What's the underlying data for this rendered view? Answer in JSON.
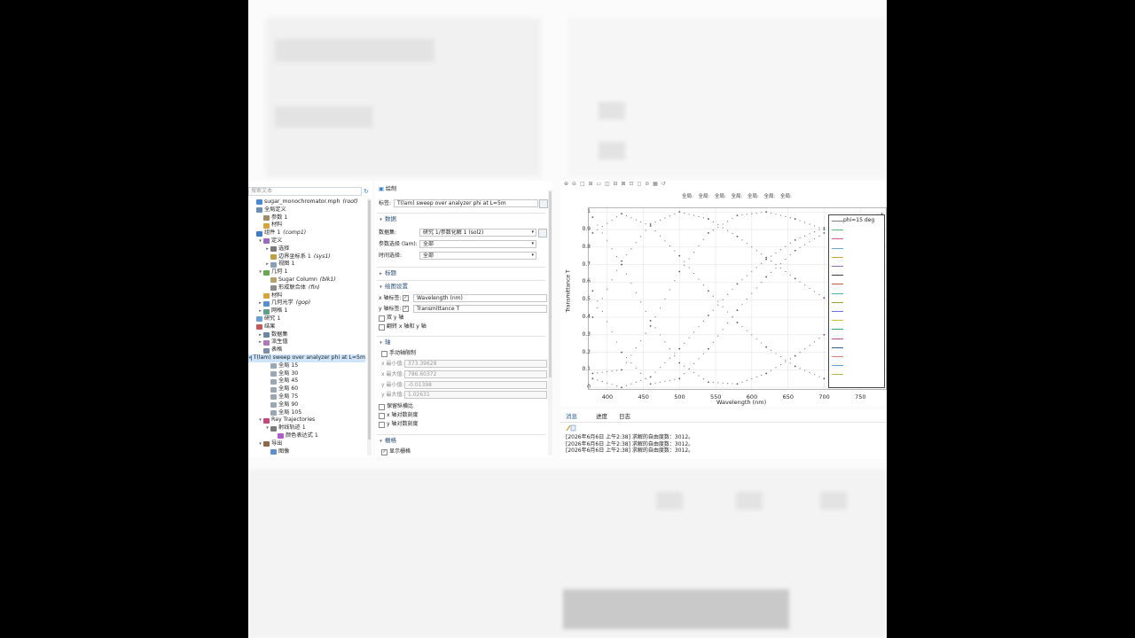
{
  "tree": {
    "search_placeholder": "搜索文本",
    "items": [
      {
        "label": "sugar_monochromator.mph",
        "tag": "(root)",
        "level": 0,
        "toggle": "",
        "icon": "file-icon",
        "color": "#4a8bd1"
      },
      {
        "label": "全局定义",
        "tag": "",
        "level": 0,
        "toggle": "",
        "icon": "globe-icon",
        "color": "#6c8fb5"
      },
      {
        "label": "参数 1",
        "tag": "",
        "level": 1,
        "toggle": "",
        "icon": "parameter-icon",
        "color": "#a08b6a"
      },
      {
        "label": "材料",
        "tag": "",
        "level": 1,
        "toggle": "",
        "icon": "materials-icon",
        "color": "#d8a43a"
      },
      {
        "label": "组件 1",
        "tag": "(comp1)",
        "level": 0,
        "toggle": "",
        "icon": "component-icon",
        "color": "#3e7cc4"
      },
      {
        "label": "定义",
        "tag": "",
        "level": 1,
        "toggle": "▾",
        "icon": "definitions-icon",
        "color": "#9a6bbf"
      },
      {
        "label": "选择",
        "tag": "",
        "level": 2,
        "toggle": "▸",
        "icon": "selection-icon",
        "color": "#7a7a7a"
      },
      {
        "label": "边界坐标系 1",
        "tag": "(sys1)",
        "level": 2,
        "toggle": "",
        "icon": "coordinate-system-icon",
        "color": "#c0a040"
      },
      {
        "label": "视图 1",
        "tag": "",
        "level": 2,
        "toggle": "▸",
        "icon": "view-icon",
        "color": "#8aa0b8"
      },
      {
        "label": "几何 1",
        "tag": "",
        "level": 1,
        "toggle": "▾",
        "icon": "geometry-icon",
        "color": "#6aa84f"
      },
      {
        "label": "Sugar Column",
        "tag": "(blk1)",
        "level": 2,
        "toggle": "",
        "icon": "block-icon",
        "color": "#b5a36e"
      },
      {
        "label": "形成联合体",
        "tag": "(fin)",
        "level": 2,
        "toggle": "",
        "icon": "form-union-icon",
        "color": "#8c8c8c"
      },
      {
        "label": "材料",
        "tag": "",
        "level": 1,
        "toggle": "",
        "icon": "materials-icon",
        "color": "#d8a43a"
      },
      {
        "label": "几何光学",
        "tag": "(gop)",
        "level": 1,
        "toggle": "▸",
        "icon": "geometrical-optics-icon",
        "color": "#5a8ecf"
      },
      {
        "label": "网格 1",
        "tag": "",
        "level": 1,
        "toggle": "▸",
        "icon": "mesh-icon",
        "color": "#5e9f8a"
      },
      {
        "label": "研究 1",
        "tag": "",
        "level": 0,
        "toggle": "",
        "icon": "study-icon",
        "color": "#6aa0d8"
      },
      {
        "label": "结果",
        "tag": "",
        "level": 0,
        "toggle": "",
        "icon": "results-icon",
        "color": "#c65a5a"
      },
      {
        "label": "数据集",
        "tag": "",
        "level": 1,
        "toggle": "▸",
        "icon": "datasets-icon",
        "color": "#6b86a6"
      },
      {
        "label": "派生值",
        "tag": "",
        "level": 1,
        "toggle": "▸",
        "icon": "derived-values-icon",
        "color": "#b07ab8"
      },
      {
        "label": "表格",
        "tag": "",
        "level": 1,
        "toggle": "",
        "icon": "tables-icon",
        "color": "#7c8fa8"
      },
      {
        "label": "T(lam) sweep over analyzer phi at L=5m",
        "tag": "",
        "level": 1,
        "toggle": "▾",
        "icon": "1d-plot-group-icon",
        "color": "#4f80b8",
        "selected": true
      },
      {
        "label": "全局 15",
        "tag": "",
        "level": 2,
        "toggle": "",
        "icon": "global-plot-icon",
        "color": "#9aa7b5"
      },
      {
        "label": "全局 30",
        "tag": "",
        "level": 2,
        "toggle": "",
        "icon": "global-plot-icon",
        "color": "#9aa7b5"
      },
      {
        "label": "全局 45",
        "tag": "",
        "level": 2,
        "toggle": "",
        "icon": "global-plot-icon",
        "color": "#9aa7b5"
      },
      {
        "label": "全局 60",
        "tag": "",
        "level": 2,
        "toggle": "",
        "icon": "global-plot-icon",
        "color": "#9aa7b5"
      },
      {
        "label": "全局 75",
        "tag": "",
        "level": 2,
        "toggle": "",
        "icon": "global-plot-icon",
        "color": "#9aa7b5"
      },
      {
        "label": "全局 90",
        "tag": "",
        "level": 2,
        "toggle": "",
        "icon": "global-plot-icon",
        "color": "#9aa7b5"
      },
      {
        "label": "全局 105",
        "tag": "",
        "level": 2,
        "toggle": "",
        "icon": "global-plot-icon",
        "color": "#9aa7b5"
      },
      {
        "label": "Ray Trajectories",
        "tag": "",
        "level": 1,
        "toggle": "▾",
        "icon": "ray-trajectories-icon",
        "color": "#c04a7a"
      },
      {
        "label": "射线轨迹 1",
        "tag": "",
        "level": 2,
        "toggle": "▾",
        "icon": "ray-trajectory-icon",
        "color": "#7a7a7a"
      },
      {
        "label": "颜色表达式 1",
        "tag": "",
        "level": 3,
        "toggle": "",
        "icon": "color-expression-icon",
        "color": "#b15cc8"
      },
      {
        "label": "导出",
        "tag": "",
        "level": 1,
        "toggle": "▾",
        "icon": "export-icon",
        "color": "#8a6a4a"
      },
      {
        "label": "图像",
        "tag": "",
        "level": 2,
        "toggle": "",
        "icon": "image-icon",
        "color": "#5a8ecf"
      }
    ]
  },
  "settings": {
    "header": "绘制",
    "label_label": "标签:",
    "label_value": "T(lam) sweep over analyzer phi at L=5m",
    "data_section": "数据",
    "dataset_label": "数据集:",
    "dataset_value": "研究 1/参数化解 1 (sol2)",
    "param_label": "参数选择 (lam):",
    "param_value": "全部",
    "time_label": "时间选择:",
    "time_value": "全部",
    "title_section": "标题",
    "plot_settings_section": "绘图设置",
    "xaxis_label": "x 轴标签:",
    "xaxis_value": "Wavelength (nm)",
    "yaxis_label": "y 轴标签:",
    "yaxis_value": "Transmittance T",
    "dual_y": "双 y 轴",
    "flip_xy": "翻转 x 轴和 y 轴",
    "axis_section": "轴",
    "manual_axis": "手动轴限制",
    "xmin_label": "x 最小值:",
    "xmin_value": "373.39628",
    "xmax_label": "x 最大值:",
    "xmax_value": "786.60372",
    "ymin_label": "y 最小值:",
    "ymin_value": "-0.01398",
    "ymax_label": "y 最大值:",
    "ymax_value": "1.02631",
    "preserve_aspect": "保留纵横比",
    "xlog": "x 轴对数刻度",
    "ylog": "y 轴对数刻度",
    "grid_section": "栅格",
    "show_grid": "显示栅格"
  },
  "graphics": {
    "title_items": [
      "全局:",
      "全局:",
      "全局:",
      "全局:",
      "全局:",
      "全局:",
      "全局:"
    ],
    "ylabel": "Transmittance T",
    "xlabel": "Wavelength (nm)",
    "yticks": [
      "1",
      "0.9",
      "0.8",
      "0.7",
      "0.6",
      "0.5",
      "0.4",
      "0.3",
      "0.2",
      "0.1",
      "0"
    ],
    "xticks": [
      "400",
      "450",
      "500",
      "550",
      "600",
      "650",
      "700",
      "750"
    ],
    "legend_title": "phi=15 deg"
  },
  "chart_data": {
    "type": "scatter",
    "title": "",
    "xlabel": "Wavelength (nm)",
    "ylabel": "Transmittance T",
    "xlim": [
      373.4,
      786.6
    ],
    "ylim": [
      -0.014,
      1.026
    ],
    "grid": true,
    "legend_position": "top-right",
    "series": [
      {
        "name": "phi=15 deg",
        "x": [
          380,
          420,
          460,
          500,
          540,
          580,
          620,
          660,
          700,
          740,
          780
        ],
        "y": [
          0.05,
          0.0,
          0.06,
          0.22,
          0.41,
          0.59,
          0.73,
          0.84,
          0.91,
          0.96,
          0.99
        ]
      },
      {
        "x": [
          380,
          420,
          460,
          500,
          540,
          580,
          620,
          660,
          700,
          740,
          780
        ],
        "y": [
          0.4,
          0.72,
          0.93,
          1.0,
          0.96,
          0.86,
          0.74,
          0.62,
          0.51,
          0.41,
          0.33
        ]
      },
      {
        "x": [
          380,
          420,
          460,
          500,
          540,
          580,
          620,
          660,
          700,
          740,
          780
        ],
        "y": [
          0.88,
          0.99,
          0.92,
          0.75,
          0.55,
          0.37,
          0.23,
          0.12,
          0.05,
          0.02,
          0.01
        ]
      },
      {
        "x": [
          380,
          420,
          460,
          500,
          540,
          580,
          620,
          660,
          700,
          740,
          780
        ],
        "y": [
          0.97,
          0.7,
          0.38,
          0.14,
          0.03,
          0.02,
          0.08,
          0.18,
          0.3,
          0.42,
          0.53
        ]
      },
      {
        "x": [
          380,
          420,
          460,
          500,
          540,
          580,
          620,
          660,
          700,
          740,
          780
        ],
        "y": [
          0.55,
          0.2,
          0.02,
          0.05,
          0.22,
          0.44,
          0.63,
          0.78,
          0.88,
          0.95,
          0.98
        ]
      },
      {
        "x": [
          380,
          420,
          460,
          500,
          540,
          580,
          620,
          660,
          700,
          740,
          780
        ],
        "y": [
          0.08,
          0.1,
          0.35,
          0.66,
          0.88,
          0.98,
          1.0,
          0.96,
          0.9,
          0.83,
          0.76
        ]
      }
    ]
  },
  "messages": {
    "tabs": [
      "消息",
      "进度",
      "日志"
    ],
    "lines": [
      "[2026年6月6日 上午2:38] 求解的自由度数：3012。",
      "[2026年6月6日 上午2:38] 求解的自由度数：3012。",
      "[2026年6月6日 上午2:38] 求解的自由度数：3012。"
    ]
  },
  "legend_colors": [
    "#7f7f7f",
    "#5fbf6f",
    "#d65f8f",
    "#6fa6d6",
    "#d6a23f",
    "#8f6fbf",
    "#3f3f3f",
    "#bf5f3f",
    "#4fb3b3",
    "#9f9f3f",
    "#6f6fdf",
    "#dfbf2f",
    "#3fa36f",
    "#af4fa3",
    "#2f5f9f",
    "#cf7f6f",
    "#5f9fdf",
    "#9fbf4f"
  ]
}
